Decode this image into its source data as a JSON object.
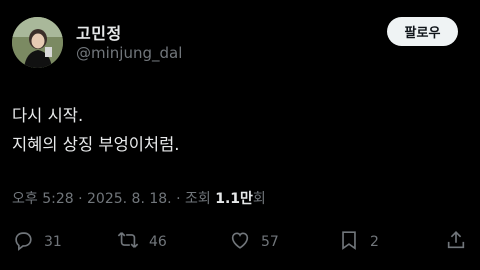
{
  "author": {
    "display_name": "고민정",
    "handle": "@minjung_dal"
  },
  "follow_button": {
    "label": "팔로우"
  },
  "tweet": {
    "lines": [
      "다시 시작.",
      "지혜의 상징 부엉이처럼."
    ]
  },
  "meta": {
    "time": "오후 5:28",
    "sep1": " · ",
    "date": "2025. 8. 18.",
    "sep2": " · ",
    "views_label": "조회 ",
    "views_count": "1.1만",
    "views_suffix": "회"
  },
  "actions": {
    "reply_count": "31",
    "retweet_count": "46",
    "like_count": "57",
    "bookmark_count": "2"
  },
  "icons": {
    "reply": "speech-bubble-icon",
    "retweet": "repost-arrows-icon",
    "like": "heart-icon",
    "bookmark": "bookmark-icon",
    "share": "share-arrow-icon"
  },
  "colors": {
    "background": "#000000",
    "text_primary": "#e7e9ea",
    "text_secondary": "#71767b",
    "follow_bg": "#eff3f4",
    "follow_text": "#0f1419"
  }
}
